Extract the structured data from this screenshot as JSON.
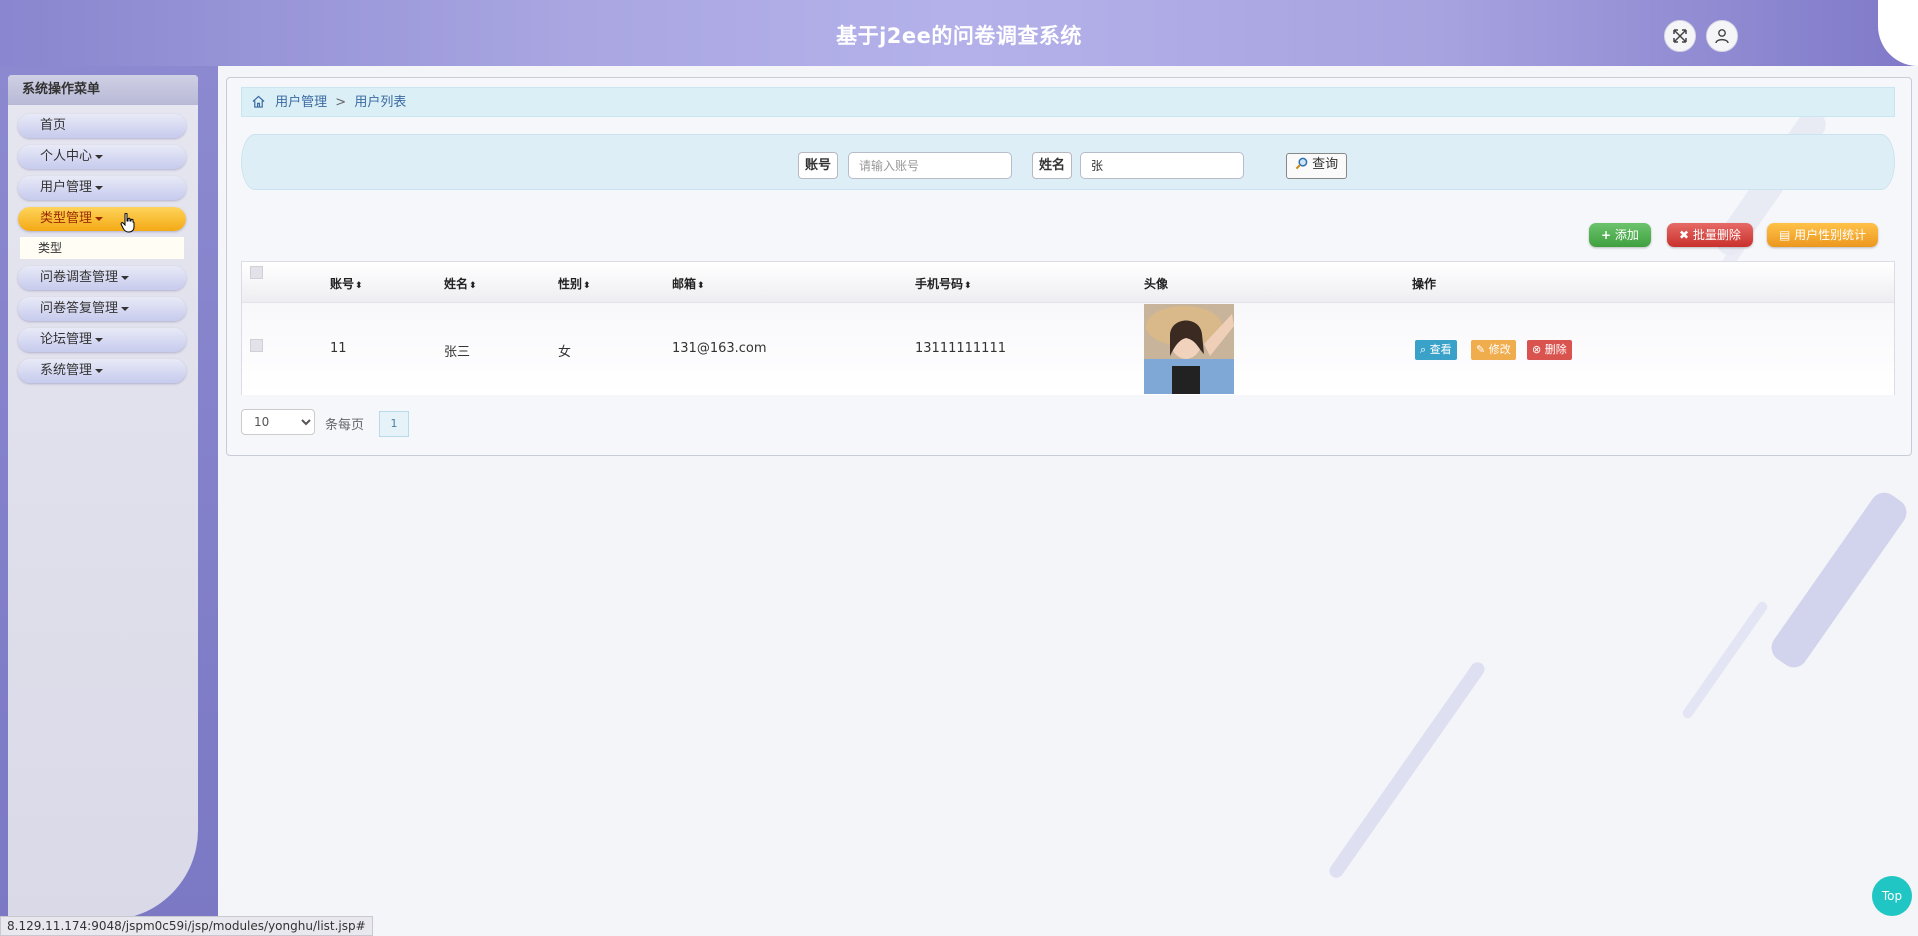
{
  "header": {
    "title": "基于j2ee的问卷调查系统",
    "fullscreen_icon": "expand-arrows-icon",
    "user_icon": "user-icon"
  },
  "sidebar": {
    "title": "系统操作菜单",
    "items": [
      {
        "label": "首页",
        "has_caret": false
      },
      {
        "label": "个人中心",
        "has_caret": true
      },
      {
        "label": "用户管理",
        "has_caret": true
      },
      {
        "label": "类型管理",
        "has_caret": true,
        "active": true
      },
      {
        "label": "问卷调查管理",
        "has_caret": true
      },
      {
        "label": "问卷答复管理",
        "has_caret": true
      },
      {
        "label": "论坛管理",
        "has_caret": true
      },
      {
        "label": "系统管理",
        "has_caret": true
      }
    ],
    "submenu": {
      "label": "类型"
    }
  },
  "breadcrumb": {
    "home_icon": "home-icon",
    "level1": "用户管理",
    "separator": ">",
    "level2": "用户列表"
  },
  "search": {
    "account_label": "账号",
    "account_placeholder": "请输入账号",
    "account_value": "",
    "name_label": "姓名",
    "name_value": "张",
    "query_label": "查询"
  },
  "actions": {
    "add_label": "添加",
    "batch_delete_label": "批量删除",
    "stats_label": "用户性别统计"
  },
  "table": {
    "columns": [
      "账号",
      "姓名",
      "性别",
      "邮箱",
      "手机号码",
      "头像",
      "操作"
    ],
    "rows": [
      {
        "account": "11",
        "name": "张三",
        "gender": "女",
        "email": "131@163.com",
        "phone": "13111111111"
      }
    ],
    "row_actions": {
      "view": "查看",
      "edit": "修改",
      "delete": "删除"
    }
  },
  "pagination": {
    "page_size": "10",
    "page_size_options": [
      "10"
    ],
    "per_page_label": "条每页",
    "current_page": "1"
  },
  "status_url": "8.129.11.174:9048/jspm0c59i/jsp/modules/yonghu/list.jsp#",
  "top_button": "Top",
  "colors": {
    "header_purple": "#a9a6e2",
    "active_menu": "#f3a915",
    "add_green": "#4caf50",
    "delete_red": "#d9534f",
    "stats_orange": "#f0a020",
    "view_blue": "#3aa1c9",
    "top_cyan": "#1fc6c4"
  }
}
